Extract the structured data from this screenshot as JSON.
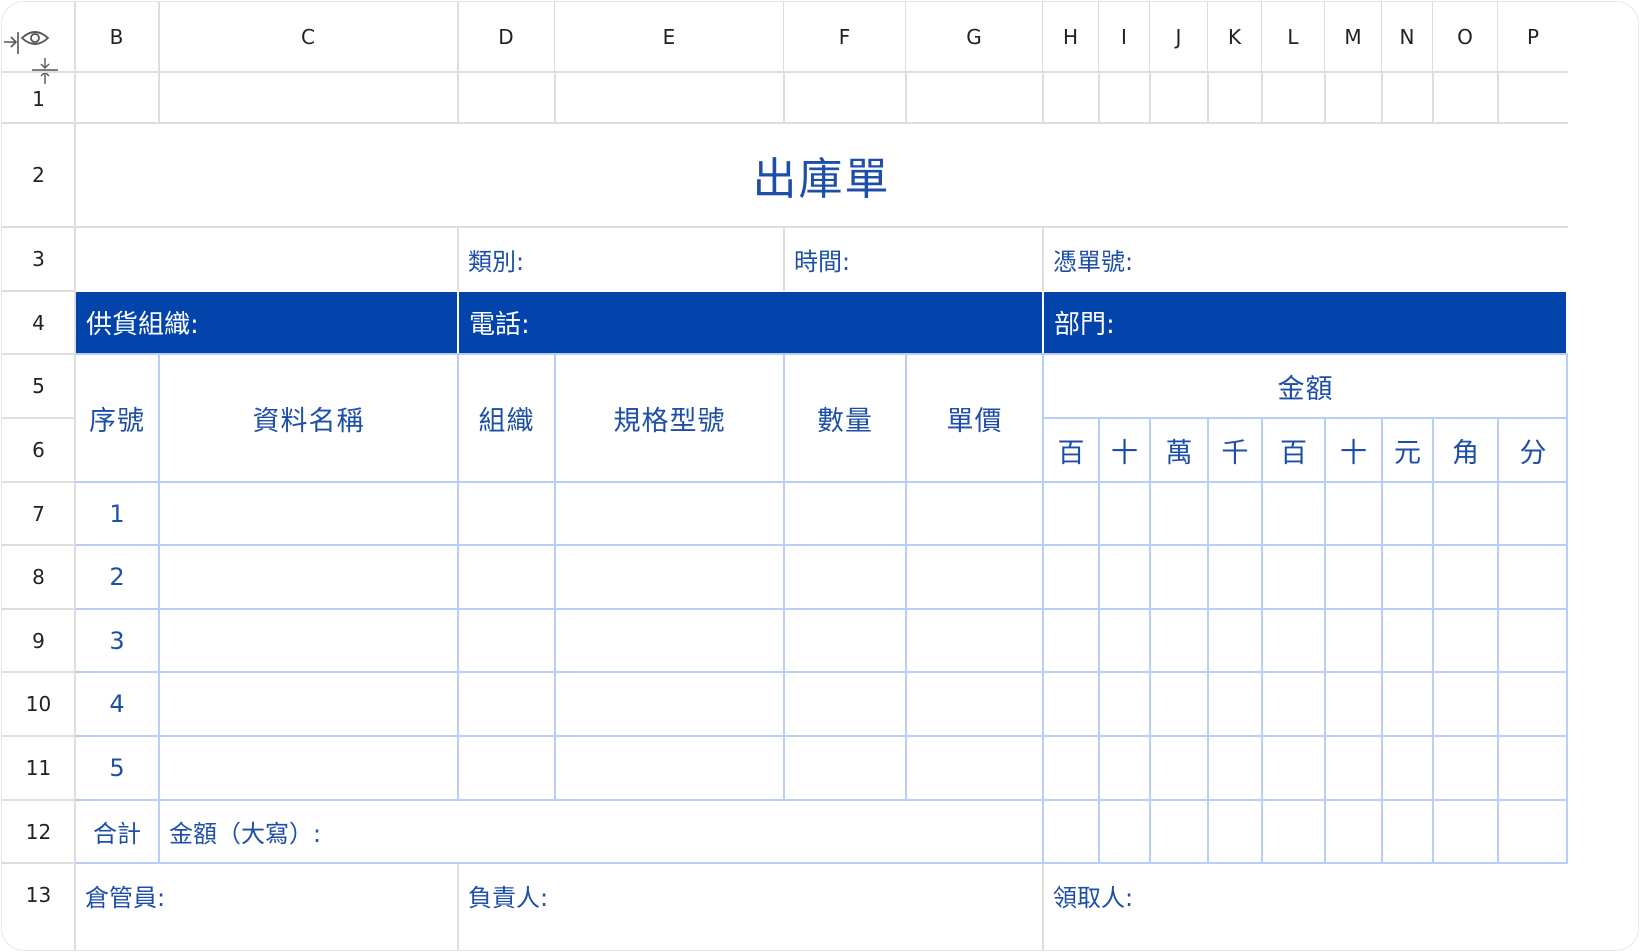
{
  "columns": [
    "B",
    "C",
    "D",
    "E",
    "F",
    "G",
    "H",
    "I",
    "J",
    "K",
    "L",
    "M",
    "N",
    "O",
    "P"
  ],
  "rows": [
    "1",
    "2",
    "3",
    "4",
    "5",
    "6",
    "7",
    "8",
    "9",
    "10",
    "11",
    "12",
    "13"
  ],
  "sheet": {
    "title": "出庫單",
    "category_label": "類別:",
    "time_label": "時間:",
    "voucher_label": "憑單號:",
    "supplier_label": "供貨組織:",
    "phone_label": "電話:",
    "dept_label": "部門:",
    "col_index": "序號",
    "col_name": "資料名稱",
    "col_org": "組織",
    "col_spec": "規格型號",
    "col_qty": "數量",
    "col_price": "單價",
    "amount_header": "金額",
    "amount_digits": [
      "百",
      "十",
      "萬",
      "千",
      "百",
      "十",
      "元",
      "角",
      "分"
    ],
    "item_numbers": [
      "1",
      "2",
      "3",
      "4",
      "5"
    ],
    "total_label": "合計",
    "total_amount_label": "金額（大寫）:",
    "keeper_label": "倉管員:",
    "owner_label": "負責人:",
    "receiver_label": "領取人:"
  }
}
